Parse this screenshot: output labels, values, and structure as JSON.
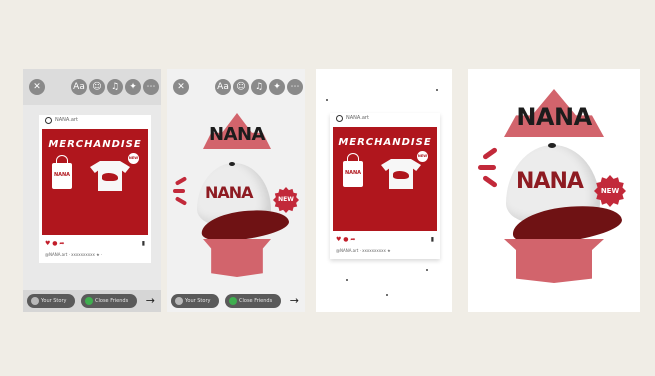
{
  "panels": {
    "story_post": {
      "toolbar": {
        "close": "✕",
        "text_tool": "Aa",
        "sticker": "☺",
        "music": "♫",
        "effects": "✦",
        "more": "⋯"
      },
      "post": {
        "username": "NANA.art",
        "banner_title": "MERCHANDISE",
        "tote_text": "NANA",
        "new_badge": "NEW",
        "actions": "♥ ● ➦",
        "bookmark": "▮",
        "caption": "@NANA.art  ·  xxxxxxxxxx ★ ·"
      },
      "bottom": {
        "your_story": "Your Story",
        "close_friends": "Close Friends",
        "send": "→"
      }
    },
    "story_cap": {
      "toolbar": {
        "close": "✕",
        "text_tool": "Aa",
        "sticker": "☺",
        "music": "♫",
        "effects": "✦",
        "more": "⋯"
      },
      "nana": "NANA",
      "cap_text": "NANA",
      "new_badge": "NEW",
      "bottom": {
        "your_story": "Your Story",
        "close_friends": "Close Friends",
        "send": "→"
      }
    },
    "layer_post": {
      "post": {
        "username": "NANA.art",
        "banner_title": "MERCHANDISE",
        "tote_text": "NANA",
        "new_badge": "NEW",
        "actions": "♥ ● ➦",
        "bookmark": "▮",
        "caption": "@NANA.art  ·  xxxxxxxxxx ★"
      }
    },
    "layer_cap": {
      "nana": "NANA",
      "cap_text": "NANA",
      "new_badge": "NEW"
    }
  },
  "colors": {
    "brand_red": "#b0161d",
    "banner_pink": "#d2646c",
    "badge_red": "#c2293a",
    "brim_dark": "#6f1214",
    "background": "#f0ede6"
  }
}
